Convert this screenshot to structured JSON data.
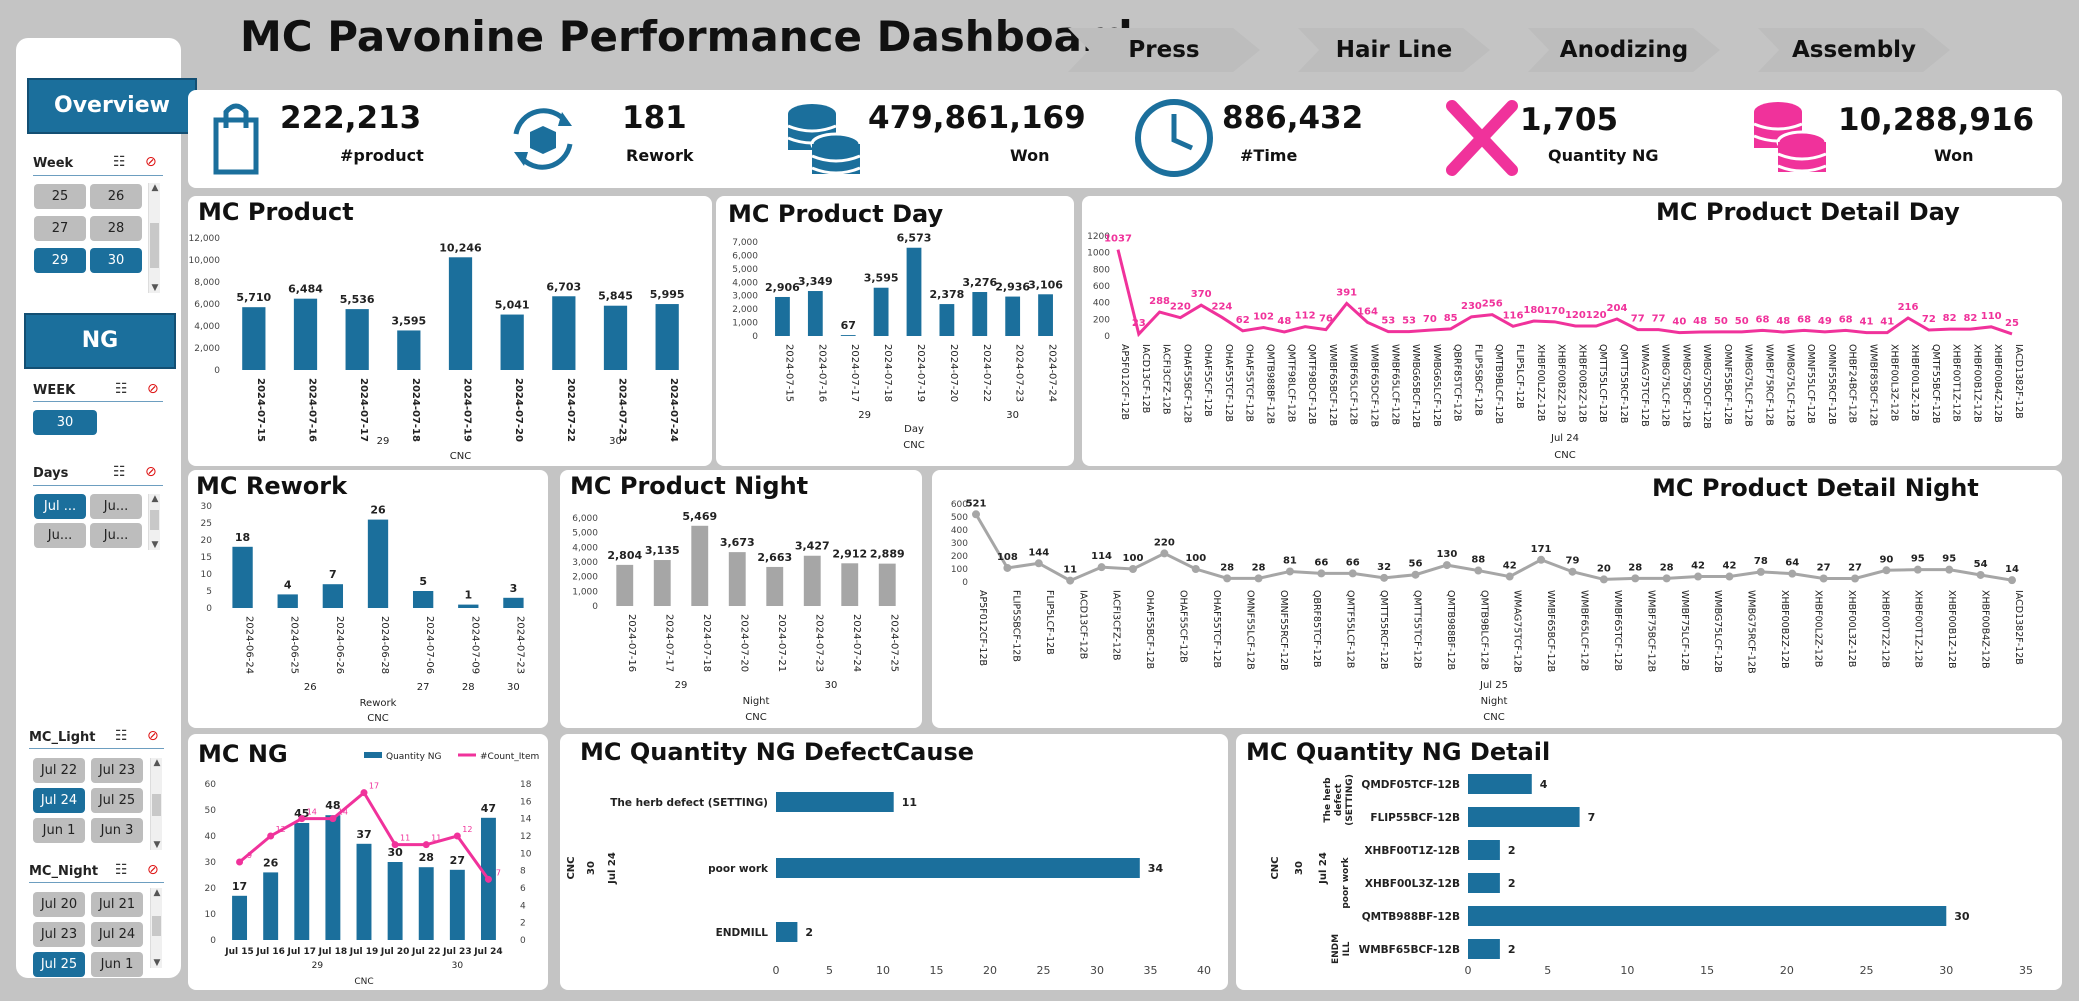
{
  "title": "MC Pavonine Performance Dashboard",
  "nav": [
    "Press",
    "Hair Line",
    "Anodizing",
    "Assembly"
  ],
  "sidebar": {
    "overview": "Overview",
    "week_label": "Week",
    "week_tiles": [
      {
        "label": "25",
        "selected": false
      },
      {
        "label": "26",
        "selected": false
      },
      {
        "label": "27",
        "selected": false
      },
      {
        "label": "28",
        "selected": false
      },
      {
        "label": "29",
        "selected": true
      },
      {
        "label": "30",
        "selected": true
      }
    ],
    "ng": "NG",
    "ng_week_label": "WEEK",
    "ng_week_tiles": [
      {
        "label": "30",
        "selected": true
      }
    ],
    "days_label": "Days",
    "days_tiles": [
      {
        "label": "Jul ...",
        "selected": true
      },
      {
        "label": "Ju...",
        "selected": false
      },
      {
        "label": "Ju...",
        "selected": false
      },
      {
        "label": "Ju...",
        "selected": false
      }
    ],
    "mc_light_label": "MC_Light",
    "mc_light_tiles": [
      {
        "label": "Jul 22",
        "selected": false
      },
      {
        "label": "Jul 23",
        "selected": false
      },
      {
        "label": "Jul 24",
        "selected": true
      },
      {
        "label": "Jul 25",
        "selected": false
      },
      {
        "label": "Jun 1",
        "selected": false
      },
      {
        "label": "Jun 3",
        "selected": false
      }
    ],
    "mc_night_label": "MC_Night",
    "mc_night_tiles": [
      {
        "label": "Jul 20",
        "selected": false
      },
      {
        "label": "Jul 21",
        "selected": false
      },
      {
        "label": "Jul 23",
        "selected": false
      },
      {
        "label": "Jul 24",
        "selected": false
      },
      {
        "label": "Jul 25",
        "selected": true
      },
      {
        "label": "Jun 1",
        "selected": false
      }
    ]
  },
  "kpis": [
    {
      "value": "222,213",
      "label": "#product",
      "icon": "shopping-bag-icon",
      "color": "#1b6f9c"
    },
    {
      "value": "181",
      "label": "Rework",
      "icon": "rework-box-icon",
      "color": "#1b6f9c"
    },
    {
      "value": "479,861,169",
      "label": "Won",
      "icon": "coins-icon",
      "color": "#1b6f9c"
    },
    {
      "value": "886,432",
      "label": "#Time",
      "icon": "clock-icon",
      "color": "#1b6f9c"
    },
    {
      "value": "1,705",
      "label": "Quantity NG",
      "icon": "x-mark-icon",
      "color": "#f0329b"
    },
    {
      "value": "10,288,916",
      "label": "Won",
      "icon": "coins-icon",
      "color": "#f0329b"
    }
  ],
  "colors": {
    "primary": "#1b6f9c",
    "secondary": "#a6a6a6",
    "accent": "#f0329b"
  },
  "panels": {
    "mc_product": "MC Product",
    "mc_product_day": "MC Product Day",
    "mc_product_detail_day": "MC Product Detail Day",
    "mc_rework": "MC Rework",
    "mc_product_night": "MC Product Night",
    "mc_product_detail_night": "MC Product Detail Night",
    "mc_ng": "MC NG",
    "mc_quantity_ng_defectcause": "MC Quantity NG DefectCause",
    "mc_quantity_ng_detail": "MC Quantity NG Detail"
  },
  "chart_data": [
    {
      "id": "mc_product",
      "type": "bar",
      "title": "MC Product",
      "categories": [
        "2024-07-15",
        "2024-07-16",
        "2024-07-17",
        "2024-07-18",
        "2024-07-19",
        "2024-07-20",
        "2024-07-22",
        "2024-07-23",
        "2024-07-24"
      ],
      "values": [
        5710,
        6484,
        5536,
        3595,
        10246,
        5041,
        6703,
        5845,
        5995
      ],
      "group_labels": [
        {
          "label": "29",
          "span": [
            0,
            5
          ]
        },
        {
          "label": "30",
          "span": [
            6,
            8
          ]
        }
      ],
      "xlabel": "CNC",
      "ylim": [
        0,
        12000
      ],
      "yticks": [
        0,
        2000,
        4000,
        6000,
        8000,
        10000,
        12000
      ]
    },
    {
      "id": "mc_product_day",
      "type": "bar",
      "title": "MC Product Day",
      "categories": [
        "2024-07-15",
        "2024-07-16",
        "2024-07-17",
        "2024-07-18",
        "2024-07-19",
        "2024-07-20",
        "2024-07-22",
        "2024-07-23",
        "2024-07-24"
      ],
      "values": [
        2906,
        3349,
        67,
        3595,
        6573,
        2378,
        3276,
        2936,
        3106
      ],
      "group_labels": [
        {
          "label": "29",
          "span": [
            0,
            5
          ]
        },
        {
          "label": "30",
          "span": [
            6,
            8
          ]
        }
      ],
      "xlabel": "Day",
      "xlabel2": "CNC",
      "ylim": [
        0,
        7000
      ],
      "yticks": [
        0,
        1000,
        2000,
        3000,
        4000,
        5000,
        6000,
        7000
      ]
    },
    {
      "id": "mc_product_detail_day",
      "type": "line",
      "title": "MC Product Detail Day",
      "categories": [
        "AP5F012CF-12B",
        "IACD13CF-12B",
        "IACFI3CFZ-12B",
        "OHAF55BCF-12B",
        "OHAF55CF-12B",
        "OHAF55TCF-12B",
        "OHAF55TCF-12B",
        "QMTB988BF-12B",
        "QMTF98LCF-12B",
        "QMTF98DCF-12B",
        "WMBF65BCF-12B",
        "WMBF65LCF-12B",
        "WMBF65DCF-12B",
        "WMBF65LCF-12B",
        "WMBG65BCF-12B",
        "WMBG65LCF-12B",
        "QBRF85TCF-12B",
        "FLIP5SBCF-12B",
        "QMTB9BLCF-12B",
        "FLIP5LCF-12B",
        "XHBF00L2Z-12B",
        "XHBF00B2Z-12B",
        "XHBF00B2Z-12B",
        "QMTT55LCF-12B",
        "QMTT55RCF-12B",
        "WMAG75TCF-12B",
        "WMBG75LCF-12B",
        "WMBG75BCF-12B",
        "WMBG75DCF-12B",
        "OMNF55BCF-12B",
        "WMBG75LCF-12B",
        "WMBF75RCF-12B",
        "WMBG75LCF-12B",
        "OMNF55LCF-12B",
        "OMNF55RCF-12B",
        "OHBF24BCF-12B",
        "WMBF85BCF-12B",
        "XHBF00L3Z-12B",
        "XHBF00L3Z-12B",
        "QMTF55BCF-12B",
        "XHBF00T1Z-12B",
        "XHBF00B1Z-12B",
        "XHBF00B4Z-12B",
        "IACD1382F-12B"
      ],
      "values": [
        1037,
        23,
        288,
        220,
        370,
        224,
        62,
        102,
        48,
        112,
        76,
        391,
        164,
        53,
        53,
        70,
        85,
        230,
        256,
        116,
        180,
        170,
        120,
        120,
        204,
        77,
        77,
        40,
        48,
        50,
        50,
        68,
        48,
        68,
        49,
        68,
        41,
        41,
        216,
        72,
        82,
        82,
        110,
        25
      ],
      "xlabel": "Jul 24",
      "xlabel2": "CNC",
      "ylim": [
        0,
        1200
      ],
      "yticks": [
        0,
        200,
        400,
        600,
        800,
        1000,
        1200
      ]
    },
    {
      "id": "mc_rework",
      "type": "bar",
      "title": "MC Rework",
      "categories": [
        "2024-06-24",
        "2024-06-25",
        "2024-06-26",
        "2024-06-28",
        "2024-07-06",
        "2024-07-09",
        "2024-07-23"
      ],
      "values": [
        18,
        4,
        7,
        26,
        5,
        1,
        3
      ],
      "group_labels": [
        {
          "label": "26",
          "span": [
            0,
            3
          ]
        },
        {
          "label": "27",
          "span": [
            4,
            4
          ]
        },
        {
          "label": "28",
          "span": [
            5,
            5
          ]
        },
        {
          "label": "30",
          "span": [
            6,
            6
          ]
        }
      ],
      "xlabel": "Rework",
      "xlabel2": "CNC",
      "ylim": [
        0,
        30
      ],
      "yticks": [
        0,
        5,
        10,
        15,
        20,
        25,
        30
      ]
    },
    {
      "id": "mc_product_night",
      "type": "bar",
      "title": "MC Product Night",
      "categories": [
        "2024-07-16",
        "2024-07-17",
        "2024-07-18",
        "2024-07-20",
        "2024-07-21",
        "2024-07-23",
        "2024-07-24",
        "2024-07-25"
      ],
      "values": [
        2804,
        3135,
        5469,
        3673,
        2663,
        3427,
        2912,
        2889
      ],
      "group_labels": [
        {
          "label": "29",
          "span": [
            0,
            3
          ]
        },
        {
          "label": "30",
          "span": [
            4,
            7
          ]
        }
      ],
      "xlabel": "Night",
      "xlabel2": "CNC",
      "ylim": [
        0,
        6000
      ],
      "yticks": [
        0,
        1000,
        2000,
        3000,
        4000,
        5000,
        6000
      ]
    },
    {
      "id": "mc_product_detail_night",
      "type": "line",
      "title": "MC Product Detail Night",
      "categories": [
        "AP5F012CF-12B",
        "FLIP5SBCF-12B",
        "FLIP5LCF-12B",
        "IACD13CF-12B",
        "IACFI3CFZ-12B",
        "OHAF55BCF-12B",
        "OHAF55CF-12B",
        "OHAF55TCF-12B",
        "OMNF55LCF-12B",
        "OMNF55RCF-12B",
        "QBRF85TCF-12B",
        "QMTF55LCF-12B",
        "QMTT55RCF-12B",
        "QMTT55TCF-12B",
        "QMTB988BF-12B",
        "QMTB9BLCF-12B",
        "WMAG75TCF-12B",
        "WMBF65BCF-12B",
        "WMBF65LCF-12B",
        "WMBF65TCF-12B",
        "WMBF75BCF-12B",
        "WMBF75LCF-12B",
        "WMBG75LCF-12B",
        "WMBG75RCF-12B",
        "XHBF00B2Z-12B",
        "XHBF00L2Z-12B",
        "XHBF00L3Z-12B",
        "XHBF00T2Z-12B",
        "XHBF00T1Z-12B",
        "XHBF00B1Z-12B",
        "XHBF00B4Z-12B",
        "IACD1382F-12B"
      ],
      "values": [
        521,
        108,
        144,
        11,
        114,
        100,
        220,
        100,
        28,
        28,
        81,
        66,
        66,
        32,
        56,
        130,
        88,
        42,
        171,
        79,
        20,
        28,
        28,
        42,
        42,
        78,
        64,
        27,
        27,
        90,
        95,
        95,
        54,
        14
      ],
      "xlabel": "Jul 25",
      "xlabel2": "Night",
      "xlabel3": "CNC",
      "ylim": [
        0,
        600
      ],
      "yticks": [
        0,
        100,
        200,
        300,
        400,
        500,
        600
      ]
    },
    {
      "id": "mc_ng",
      "type": "bar",
      "title": "MC NG",
      "categories": [
        "Jul 15",
        "Jul 16",
        "Jul 17",
        "Jul 18",
        "Jul 19",
        "Jul 20",
        "Jul 22",
        "Jul 23",
        "Jul 24"
      ],
      "series": [
        {
          "name": "Quantity NG",
          "type": "bar",
          "values": [
            17,
            26,
            45,
            48,
            37,
            30,
            28,
            27,
            47
          ]
        },
        {
          "name": "#Count_Item",
          "type": "line",
          "values": [
            9,
            12,
            14,
            14,
            17,
            11,
            11,
            12,
            7
          ]
        }
      ],
      "group_labels": [
        {
          "label": "29",
          "span": [
            0,
            5
          ]
        },
        {
          "label": "30",
          "span": [
            6,
            8
          ]
        }
      ],
      "xlabel": "CNC",
      "ylim": [
        0,
        60
      ],
      "yticks": [
        0,
        10,
        20,
        30,
        40,
        50,
        60
      ],
      "y2lim": [
        0,
        18
      ],
      "y2ticks": [
        0,
        2,
        4,
        6,
        8,
        10,
        12,
        14,
        16,
        18
      ],
      "legend": "top-right"
    },
    {
      "id": "mc_quantity_ng_defectcause",
      "type": "bar",
      "orientation": "horizontal",
      "title": "MC Quantity NG DefectCause",
      "categories": [
        "The herb defect (SETTING)",
        "poor work",
        "ENDMILL"
      ],
      "values": [
        11,
        34,
        2
      ],
      "row_group_labels": [
        "CNC",
        "30",
        "Jul 24"
      ],
      "xlim": [
        0,
        40
      ],
      "xticks": [
        0,
        5,
        10,
        15,
        20,
        25,
        30,
        35,
        40
      ]
    },
    {
      "id": "mc_quantity_ng_detail",
      "type": "bar",
      "orientation": "horizontal",
      "title": "MC Quantity NG Detail",
      "categories": [
        "QMDF05TCF-12B",
        "FLIP55BCF-12B",
        "XHBF00T1Z-12B",
        "XHBF00L3Z-12B",
        "QMTB988BF-12B",
        "WMBF65BCF-12B"
      ],
      "values": [
        4,
        7,
        2,
        2,
        30,
        2
      ],
      "cause_groups": [
        {
          "label": "The herb defect (SETTING)",
          "span": [
            0,
            1
          ]
        },
        {
          "label": "poor work",
          "span": [
            2,
            4
          ]
        },
        {
          "label": "ENDMILL",
          "span": [
            5,
            5
          ]
        }
      ],
      "row_group_labels": [
        "CNC",
        "30",
        "Jul 24"
      ],
      "xlim": [
        0,
        35
      ],
      "xticks": [
        0,
        5,
        10,
        15,
        20,
        25,
        30,
        35
      ]
    }
  ]
}
